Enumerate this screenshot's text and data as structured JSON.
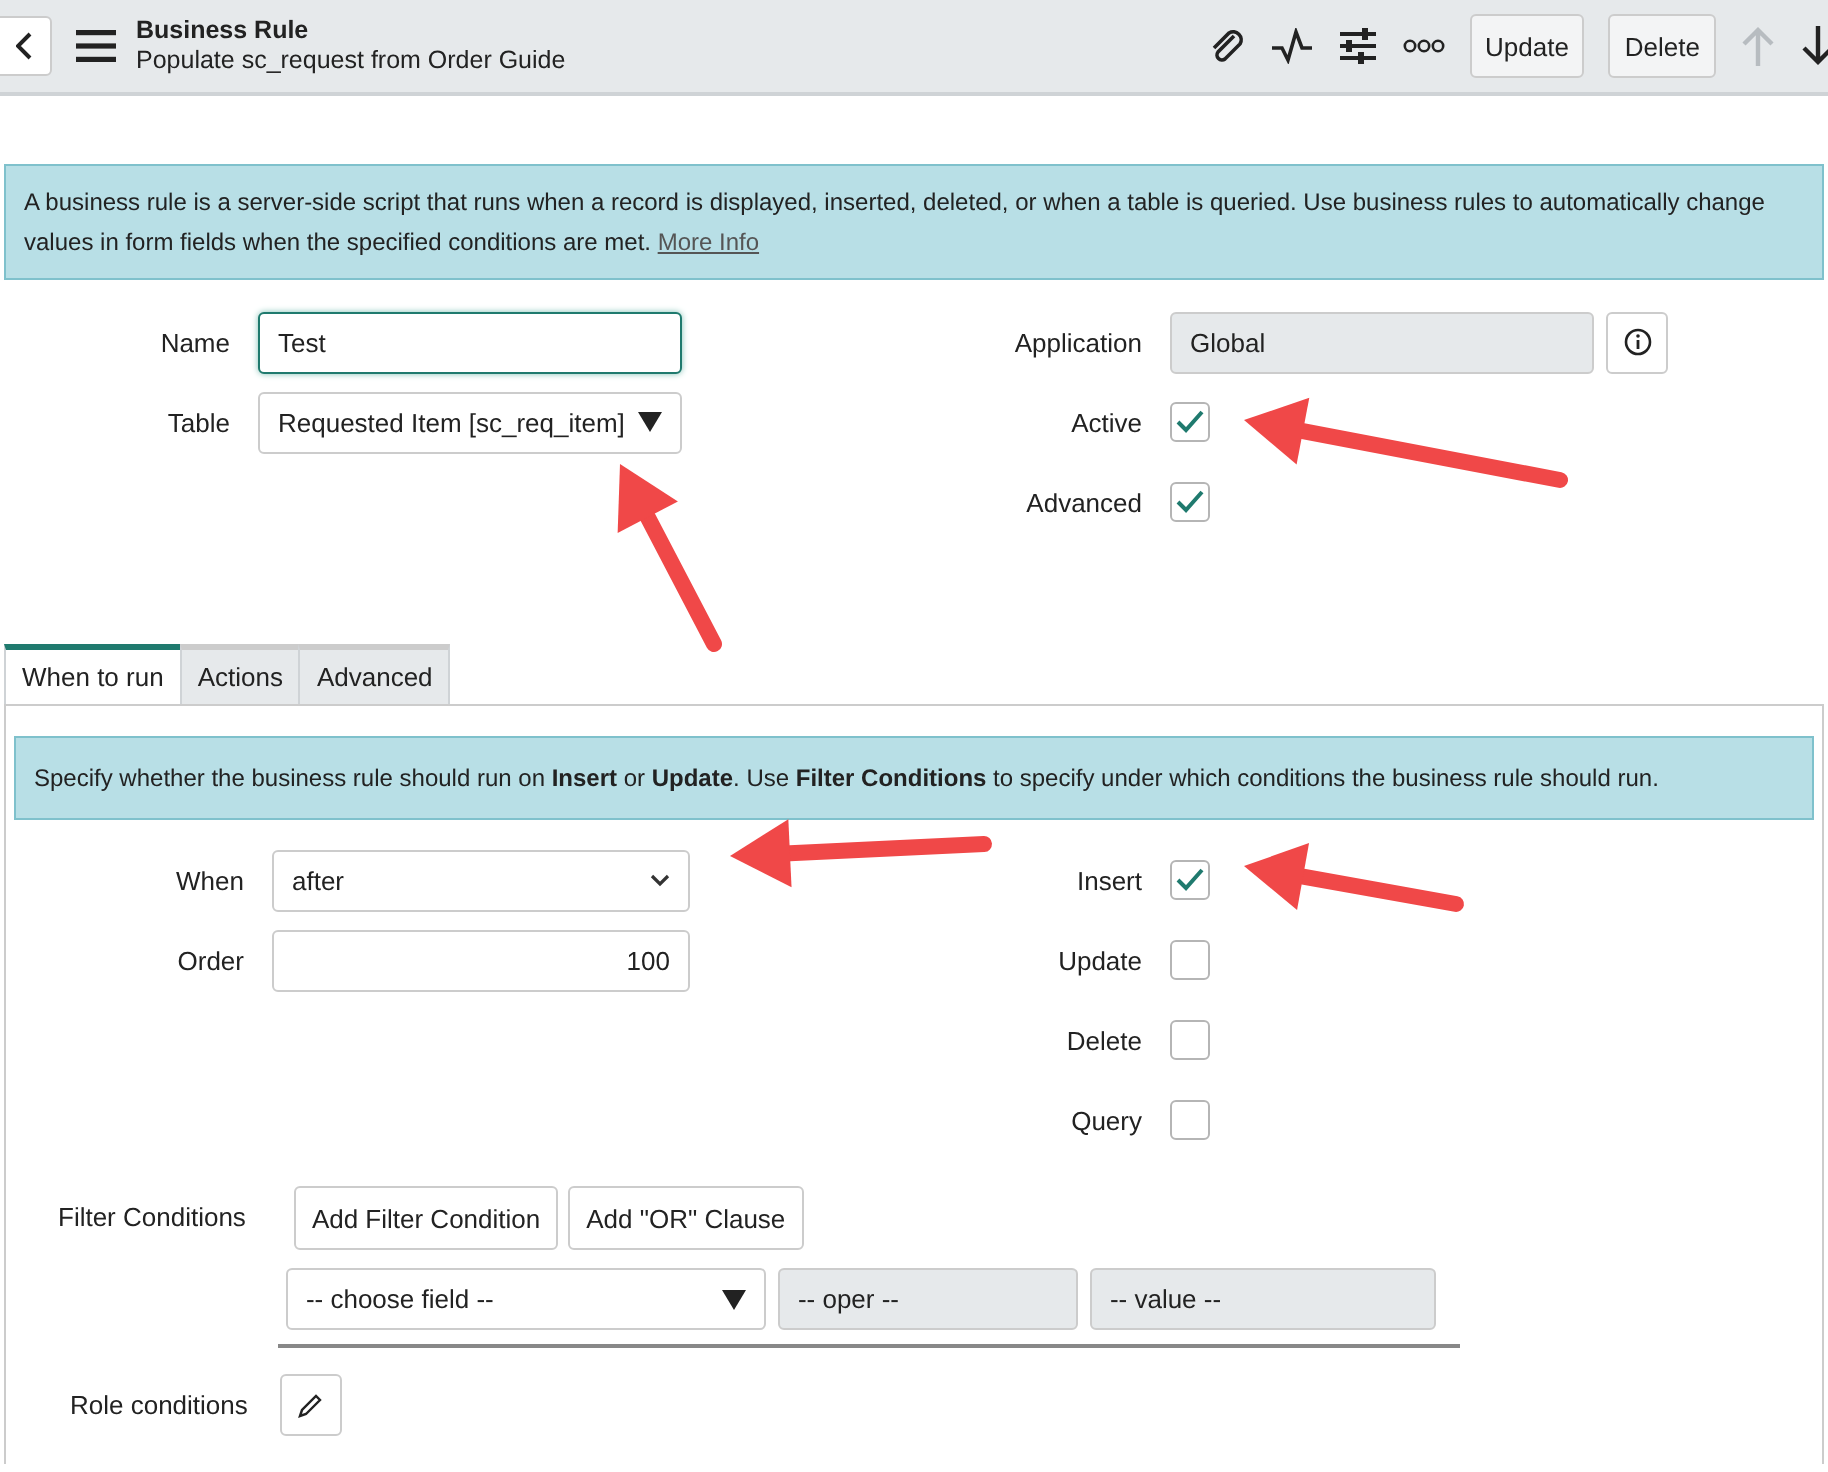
{
  "header": {
    "title": "Business Rule",
    "subtitle": "Populate sc_request from Order Guide",
    "buttons": [
      "Update",
      "Delete"
    ]
  },
  "info": {
    "text": "A business rule is a server-side script that runs when a record is displayed, inserted, deleted, or when a table is queried. Use business rules to automatically change values in form fields when the specified conditions are met.",
    "link": "More Info"
  },
  "form": {
    "left": [
      {
        "label": "Name",
        "kind": "text",
        "value": "Test",
        "focused": true
      },
      {
        "label": "Table",
        "kind": "choice",
        "value": "Requested Item [sc_req_item]"
      }
    ],
    "right": [
      {
        "label": "Application",
        "kind": "readonly",
        "value": "Global"
      },
      {
        "label": "Active",
        "kind": "checkbox",
        "checked": true
      },
      {
        "label": "Advanced",
        "kind": "checkbox",
        "checked": true
      }
    ]
  },
  "tabs": [
    {
      "label": "When to run",
      "selected": true
    },
    {
      "label": "Actions",
      "selected": false
    },
    {
      "label": "Advanced",
      "selected": false
    }
  ],
  "tab_panel": {
    "info": "Specify whether the business rule should run on **Insert** or **Update**. Use **Filter Conditions** to specify under which conditions the business rule should run.",
    "left": [
      {
        "label": "When",
        "kind": "select",
        "value": "after"
      },
      {
        "label": "Order",
        "kind": "number",
        "value": "100"
      }
    ],
    "right": [
      {
        "label": "Insert",
        "kind": "checkbox",
        "checked": true
      },
      {
        "label": "Update",
        "kind": "checkbox",
        "checked": false
      },
      {
        "label": "Delete",
        "kind": "checkbox",
        "checked": false
      },
      {
        "label": "Query",
        "kind": "checkbox",
        "checked": false
      }
    ],
    "filter": {
      "label": "Filter Conditions",
      "buttons": [
        "Add Filter Condition",
        "Add \"OR\" Clause"
      ],
      "field": "-- choose field --",
      "operator": "-- oper --",
      "value": "-- value --"
    },
    "role": {
      "label": "Role conditions"
    }
  }
}
